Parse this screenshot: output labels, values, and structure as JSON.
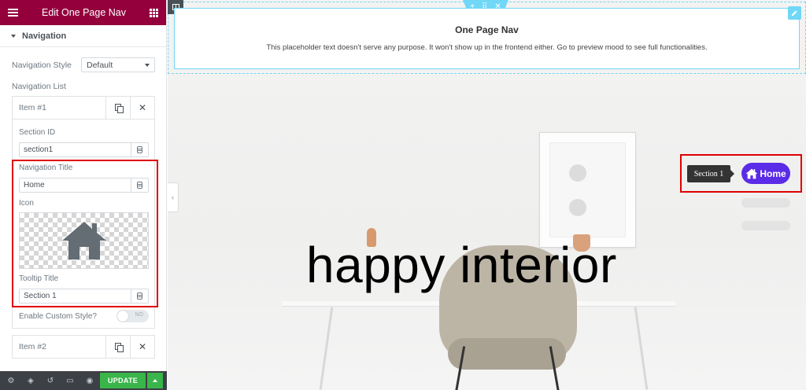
{
  "panel": {
    "title": "Edit One Page Nav",
    "section_label": "Navigation",
    "navigation_style_label": "Navigation Style",
    "navigation_style_value": "Default",
    "navigation_list_label": "Navigation List",
    "items": [
      {
        "name": "Item #1",
        "section_id_label": "Section ID",
        "section_id_value": "section1",
        "nav_title_label": "Navigation Title",
        "nav_title_value": "Home",
        "icon_label": "Icon",
        "icon_name": "home-icon",
        "tooltip_label": "Tooltip Title",
        "tooltip_value": "Section 1",
        "custom_style_label": "Enable Custom Style?",
        "custom_style_toggle": "NO"
      },
      {
        "name": "Item #2"
      }
    ],
    "footer": {
      "update_label": "UPDATE"
    },
    "colors": {
      "header": "#93003c",
      "update": "#39b54a",
      "highlight": "#e00000"
    }
  },
  "widget": {
    "title": "One Page Nav",
    "description": "This placeholder text doesn't serve any purpose. It won't show up in the frontend either. Go to preview mood to see full functionalities."
  },
  "canvas": {
    "hero_text": "happy interior",
    "nav": {
      "tooltip": "Section 1",
      "active_label": "Home",
      "active_color": "#5b2ce7"
    }
  }
}
